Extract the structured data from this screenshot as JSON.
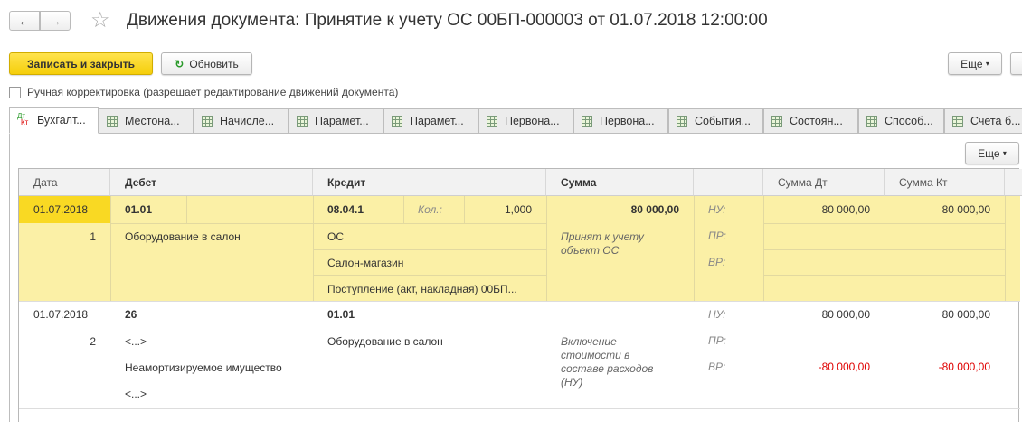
{
  "window": {
    "title": "Движения документа: Принятие к учету ОС 00БП-000003 от 01.07.2018 12:00:00",
    "back": "←",
    "forward": "→",
    "star": "☆"
  },
  "toolbar": {
    "save_close": "Записать и закрыть",
    "refresh": "Обновить",
    "more": "Еще",
    "more2": "⋮"
  },
  "manual": {
    "label": "Ручная корректировка (разрешает редактирование движений документа)",
    "checked": false
  },
  "tabs": [
    {
      "label": "Бухгалт...",
      "icon": "dt-kt-icon"
    },
    {
      "label": "Местона..."
    },
    {
      "label": "Начисле..."
    },
    {
      "label": "Парамет..."
    },
    {
      "label": "Парамет..."
    },
    {
      "label": "Первона..."
    },
    {
      "label": "Первона..."
    },
    {
      "label": "События..."
    },
    {
      "label": "Состоян..."
    },
    {
      "label": "Способ..."
    },
    {
      "label": "Счета б..."
    }
  ],
  "dtkt": {
    "dt": "Дт",
    "kt": "Кт"
  },
  "table_more": "Еще",
  "columns": {
    "date": "Дата",
    "debit": "Дебет",
    "credit": "Кредит",
    "sum": "Сумма",
    "sum_dt": "Сумма Дт",
    "sum_kt": "Сумма Кт"
  },
  "rows": [
    {
      "date": "01.07.2018",
      "num": "1",
      "debit": "01.01",
      "debit_sub": [
        "Оборудование в салон"
      ],
      "credit": "08.04.1",
      "qty_label": "Кол.:",
      "qty": "1,000",
      "credit_sub": [
        "ОС",
        "Салон-магазин",
        "Поступление (акт, накладная) 00БП..."
      ],
      "sum": "80 000,00",
      "content": "Принят к учету объект ОС",
      "labels": [
        "НУ:",
        "ПР:",
        "ВР:"
      ],
      "sum_dt": [
        "80 000,00",
        "",
        ""
      ],
      "sum_kt": [
        "80 000,00",
        "",
        ""
      ]
    },
    {
      "date": "01.07.2018",
      "num": "2",
      "debit": "26",
      "debit_sub": [
        "<...>",
        "Неамортизируемое имущество",
        "<...>"
      ],
      "credit": "01.01",
      "credit_sub": [
        "Оборудование в салон"
      ],
      "sum": "",
      "content": "Включение стоимости в составе расходов (НУ)",
      "labels": [
        "НУ:",
        "ПР:",
        "ВР:"
      ],
      "sum_dt": [
        "80 000,00",
        "",
        "-80 000,00"
      ],
      "sum_kt": [
        "80 000,00",
        "",
        "-80 000,00"
      ]
    }
  ]
}
